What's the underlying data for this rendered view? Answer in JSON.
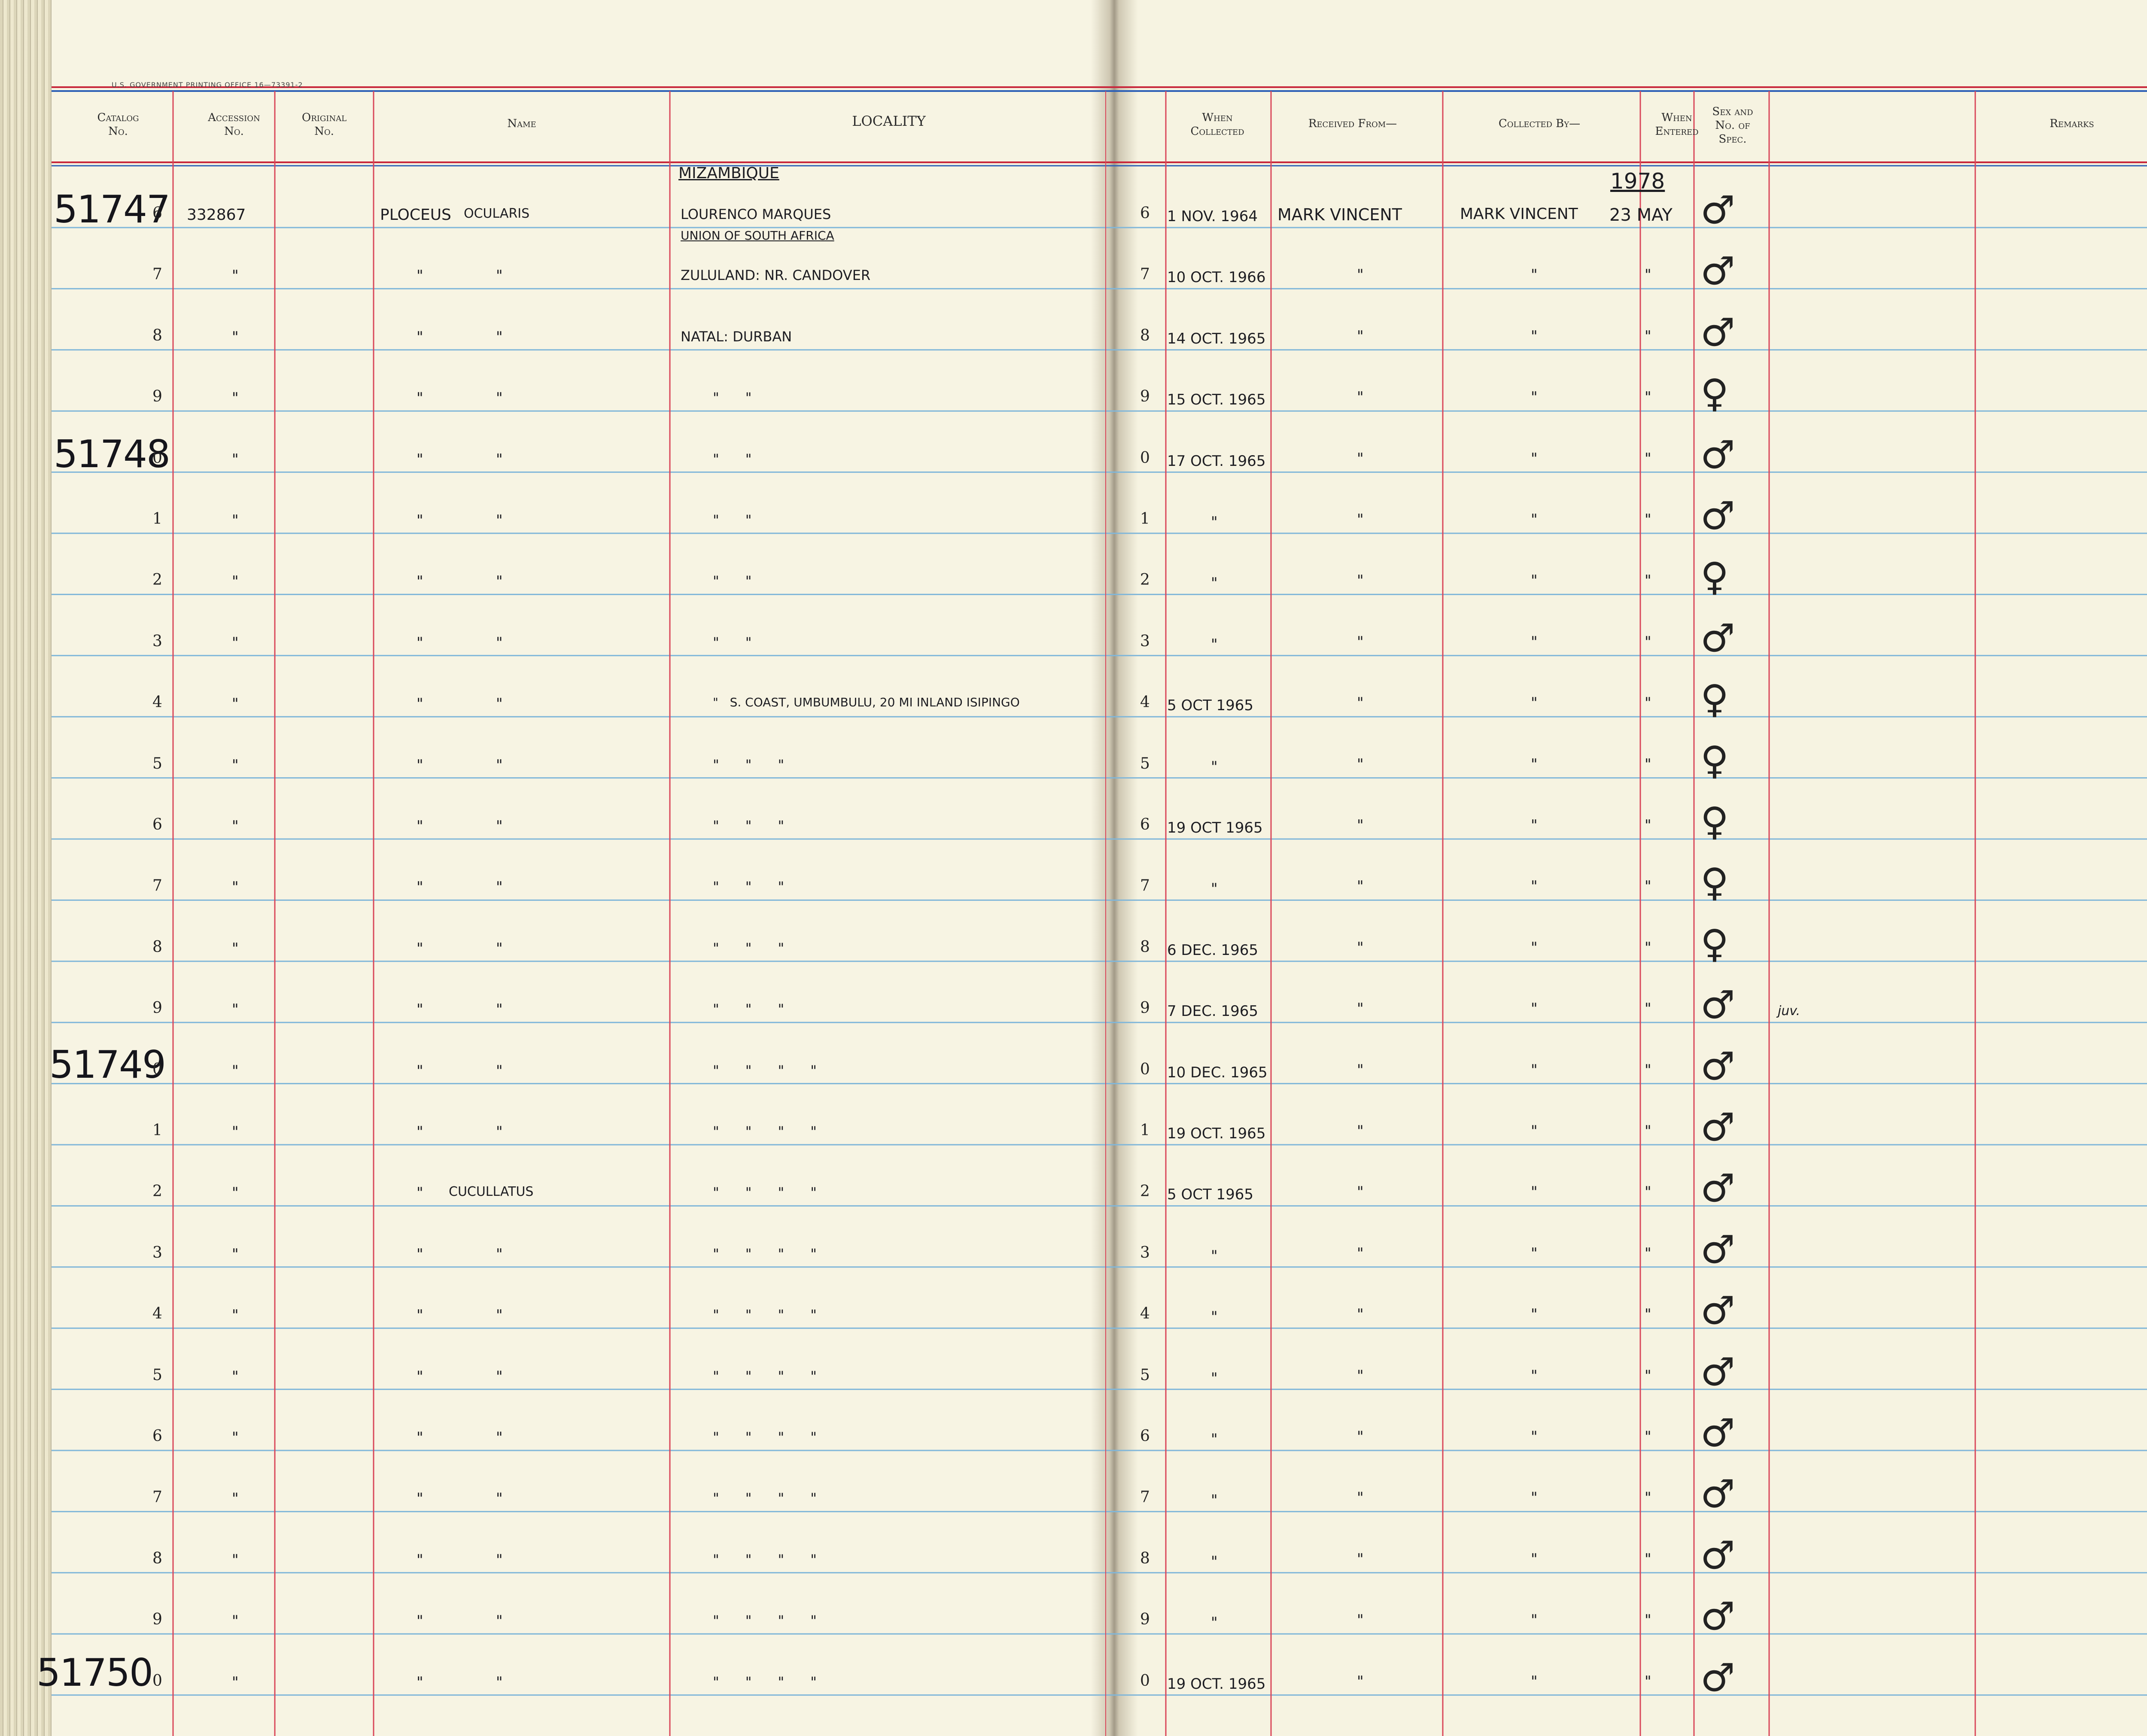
{
  "printer_line": "U.S. GOVERNMENT PRINTING OFFICE  16—73391-2",
  "headers": {
    "catalog": "Catalog\nNo.",
    "accession": "Accession\nNo.",
    "original": "Original\nNo.",
    "name": "Name",
    "locality": "LOCALITY",
    "when_collected": "When\nCollected",
    "received_from": "Received From—",
    "collected_by": "Collected By—",
    "when_entered": "When\nEntered",
    "sex": "Sex and\nNo. of\nSpec.",
    "remarks": "Remarks"
  },
  "catalog_prefixes": [
    "51747",
    "51748",
    "51749",
    "51750"
  ],
  "top_entry": {
    "locality_country": "MIZAMBIQUE",
    "year": "1978"
  },
  "rows": [
    {
      "n": "6",
      "acc": "332867",
      "name_g": "PLOCEUS",
      "name_s": "OCULARIS",
      "loc": "LOURENCO MARQUES",
      "loc_sub": "UNION OF SOUTH AFRICA",
      "date": "1 NOV. 1964",
      "recv": "MARK VINCENT",
      "coll": "MARK VINCENT",
      "entered": "23 MAY",
      "sex": "♂",
      "remark": ""
    },
    {
      "n": "7",
      "acc": "\"",
      "name_g": "\"",
      "name_s": "\"",
      "loc": "ZULULAND: NR. CANDOVER",
      "date": "10 OCT. 1966",
      "recv": "\"",
      "coll": "\"",
      "entered": "\"",
      "sex": "♂",
      "remark": ""
    },
    {
      "n": "8",
      "acc": "\"",
      "name_g": "\"",
      "name_s": "\"",
      "loc": "NATAL: DURBAN",
      "date": "14 OCT. 1965",
      "recv": "\"",
      "coll": "\"",
      "entered": "\"",
      "sex": "♂",
      "remark": ""
    },
    {
      "n": "9",
      "acc": "\"",
      "name_g": "\"",
      "name_s": "\"",
      "loc": "\"      \"",
      "date": "15 OCT. 1965",
      "recv": "\"",
      "coll": "\"",
      "entered": "\"",
      "sex": "♀",
      "remark": ""
    },
    {
      "n": "0",
      "acc": "\"",
      "name_g": "\"",
      "name_s": "\"",
      "loc": "\"      \"",
      "date": "17 OCT. 1965",
      "recv": "\"",
      "coll": "\"",
      "entered": "\"",
      "sex": "♂",
      "remark": ""
    },
    {
      "n": "1",
      "acc": "\"",
      "name_g": "\"",
      "name_s": "\"",
      "loc": "\"      \"",
      "date": "\"",
      "recv": "\"",
      "coll": "\"",
      "entered": "\"",
      "sex": "♂",
      "remark": ""
    },
    {
      "n": "2",
      "acc": "\"",
      "name_g": "\"",
      "name_s": "\"",
      "loc": "\"      \"",
      "date": "\"",
      "recv": "\"",
      "coll": "\"",
      "entered": "\"",
      "sex": "♀",
      "remark": ""
    },
    {
      "n": "3",
      "acc": "\"",
      "name_g": "\"",
      "name_s": "\"",
      "loc": "\"      \"",
      "date": "\"",
      "recv": "\"",
      "coll": "\"",
      "entered": "\"",
      "sex": "♂",
      "remark": ""
    },
    {
      "n": "4",
      "acc": "\"",
      "name_g": "\"",
      "name_s": "\"",
      "loc": "\"   S. COAST, UMBUMBULU, 20 MI INLAND ISIPINGO",
      "date": "5 OCT 1965",
      "recv": "\"",
      "coll": "\"",
      "entered": "\"",
      "sex": "♀",
      "remark": ""
    },
    {
      "n": "5",
      "acc": "\"",
      "name_g": "\"",
      "name_s": "\"",
      "loc": "\"      \"      \"",
      "date": "\"",
      "recv": "\"",
      "coll": "\"",
      "entered": "\"",
      "sex": "♀",
      "remark": ""
    },
    {
      "n": "6",
      "acc": "\"",
      "name_g": "\"",
      "name_s": "\"",
      "loc": "\"      \"      \"",
      "date": "19 OCT 1965",
      "recv": "\"",
      "coll": "\"",
      "entered": "\"",
      "sex": "♀",
      "remark": ""
    },
    {
      "n": "7",
      "acc": "\"",
      "name_g": "\"",
      "name_s": "\"",
      "loc": "\"      \"      \"",
      "date": "\"",
      "recv": "\"",
      "coll": "\"",
      "entered": "\"",
      "sex": "♀",
      "remark": ""
    },
    {
      "n": "8",
      "acc": "\"",
      "name_g": "\"",
      "name_s": "\"",
      "loc": "\"      \"      \"",
      "date": "6 DEC. 1965",
      "recv": "\"",
      "coll": "\"",
      "entered": "\"",
      "sex": "♀",
      "remark": ""
    },
    {
      "n": "9",
      "acc": "\"",
      "name_g": "\"",
      "name_s": "\"",
      "loc": "\"      \"      \"",
      "date": "7 DEC. 1965",
      "recv": "\"",
      "coll": "\"",
      "entered": "\"",
      "sex": "♂",
      "remark": "juv."
    },
    {
      "n": "0",
      "acc": "\"",
      "name_g": "\"",
      "name_s": "\"",
      "loc": "\"      \"      \"      \"",
      "date": "10 DEC. 1965",
      "recv": "\"",
      "coll": "\"",
      "entered": "\"",
      "sex": "♂",
      "remark": ""
    },
    {
      "n": "1",
      "acc": "\"",
      "name_g": "\"",
      "name_s": "\"",
      "loc": "\"      \"      \"      \"",
      "date": "19 OCT. 1965",
      "recv": "\"",
      "coll": "\"",
      "entered": "\"",
      "sex": "♂",
      "remark": ""
    },
    {
      "n": "2",
      "acc": "\"",
      "name_g": "\"",
      "name_s": "CUCULLATUS",
      "loc": "\"      \"      \"      \"",
      "date": "5 OCT 1965",
      "recv": "\"",
      "coll": "\"",
      "entered": "\"",
      "sex": "♂",
      "remark": ""
    },
    {
      "n": "3",
      "acc": "\"",
      "name_g": "\"",
      "name_s": "\"",
      "loc": "\"      \"      \"      \"",
      "date": "\"",
      "recv": "\"",
      "coll": "\"",
      "entered": "\"",
      "sex": "♂",
      "remark": ""
    },
    {
      "n": "4",
      "acc": "\"",
      "name_g": "\"",
      "name_s": "\"",
      "loc": "\"      \"      \"      \"",
      "date": "\"",
      "recv": "\"",
      "coll": "\"",
      "entered": "\"",
      "sex": "♂",
      "remark": ""
    },
    {
      "n": "5",
      "acc": "\"",
      "name_g": "\"",
      "name_s": "\"",
      "loc": "\"      \"      \"      \"",
      "date": "\"",
      "recv": "\"",
      "coll": "\"",
      "entered": "\"",
      "sex": "♂",
      "remark": ""
    },
    {
      "n": "6",
      "acc": "\"",
      "name_g": "\"",
      "name_s": "\"",
      "loc": "\"      \"      \"      \"",
      "date": "\"",
      "recv": "\"",
      "coll": "\"",
      "entered": "\"",
      "sex": "♂",
      "remark": ""
    },
    {
      "n": "7",
      "acc": "\"",
      "name_g": "\"",
      "name_s": "\"",
      "loc": "\"      \"      \"      \"",
      "date": "\"",
      "recv": "\"",
      "coll": "\"",
      "entered": "\"",
      "sex": "♂",
      "remark": ""
    },
    {
      "n": "8",
      "acc": "\"",
      "name_g": "\"",
      "name_s": "\"",
      "loc": "\"      \"      \"      \"",
      "date": "\"",
      "recv": "\"",
      "coll": "\"",
      "entered": "\"",
      "sex": "♂",
      "remark": ""
    },
    {
      "n": "9",
      "acc": "\"",
      "name_g": "\"",
      "name_s": "\"",
      "loc": "\"      \"      \"      \"",
      "date": "\"",
      "recv": "\"",
      "coll": "\"",
      "entered": "\"",
      "sex": "♂",
      "remark": ""
    },
    {
      "n": "0",
      "acc": "\"",
      "name_g": "\"",
      "name_s": "\"",
      "loc": "\"      \"      \"      \"",
      "date": "19 OCT. 1965",
      "recv": "\"",
      "coll": "\"",
      "entered": "\"",
      "sex": "♂",
      "remark": ""
    }
  ],
  "colors": {
    "rule_blue": "#7fb6d9",
    "rule_red": "#d9475a",
    "header_red": "#c8283c",
    "header_blue": "#2c5fb6",
    "ink": "#1d1d22"
  }
}
